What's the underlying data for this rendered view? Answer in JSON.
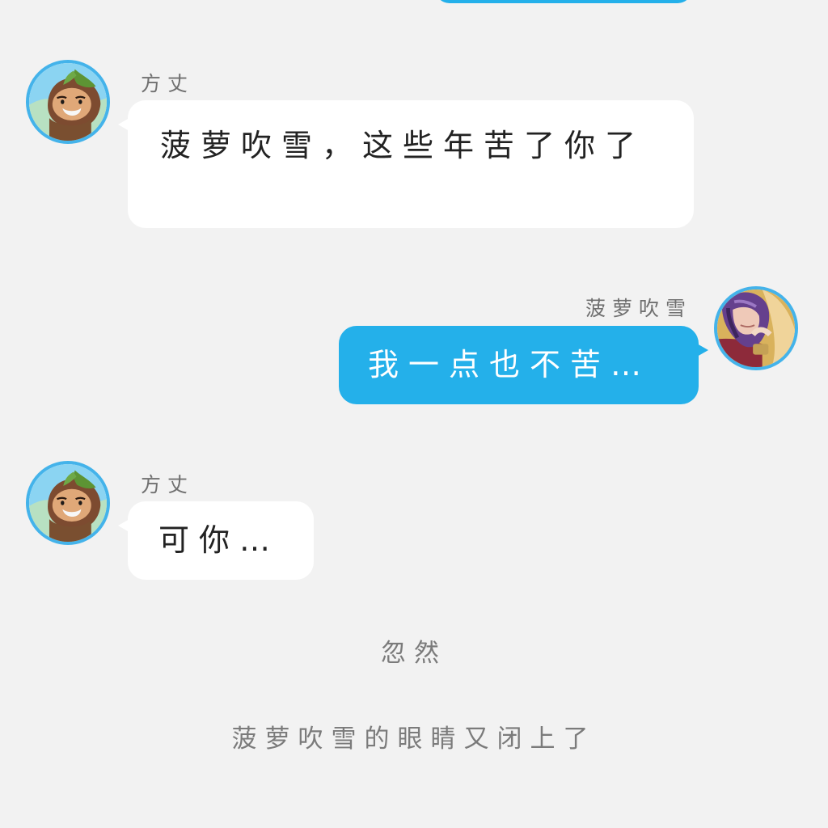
{
  "colors": {
    "background": "#f2f2f2",
    "accent_blue": "#24b0ea",
    "avatar_ring": "#44b3ea",
    "left_bubble": "#ffffff",
    "name_text": "#707070",
    "narration_text": "#7b7b7b"
  },
  "messages": [
    {
      "side": "left",
      "sender": "方丈",
      "avatar": "abbot-avatar",
      "text": "菠萝吹雪，这些年苦了你了"
    },
    {
      "side": "right",
      "sender": "菠萝吹雪",
      "avatar": "purple-hair-avatar",
      "text": "我一点也不苦…"
    },
    {
      "side": "left",
      "sender": "方丈",
      "avatar": "abbot-avatar",
      "text": "可你…"
    }
  ],
  "narration": [
    "忽然",
    "菠萝吹雪的眼睛又闭上了"
  ]
}
